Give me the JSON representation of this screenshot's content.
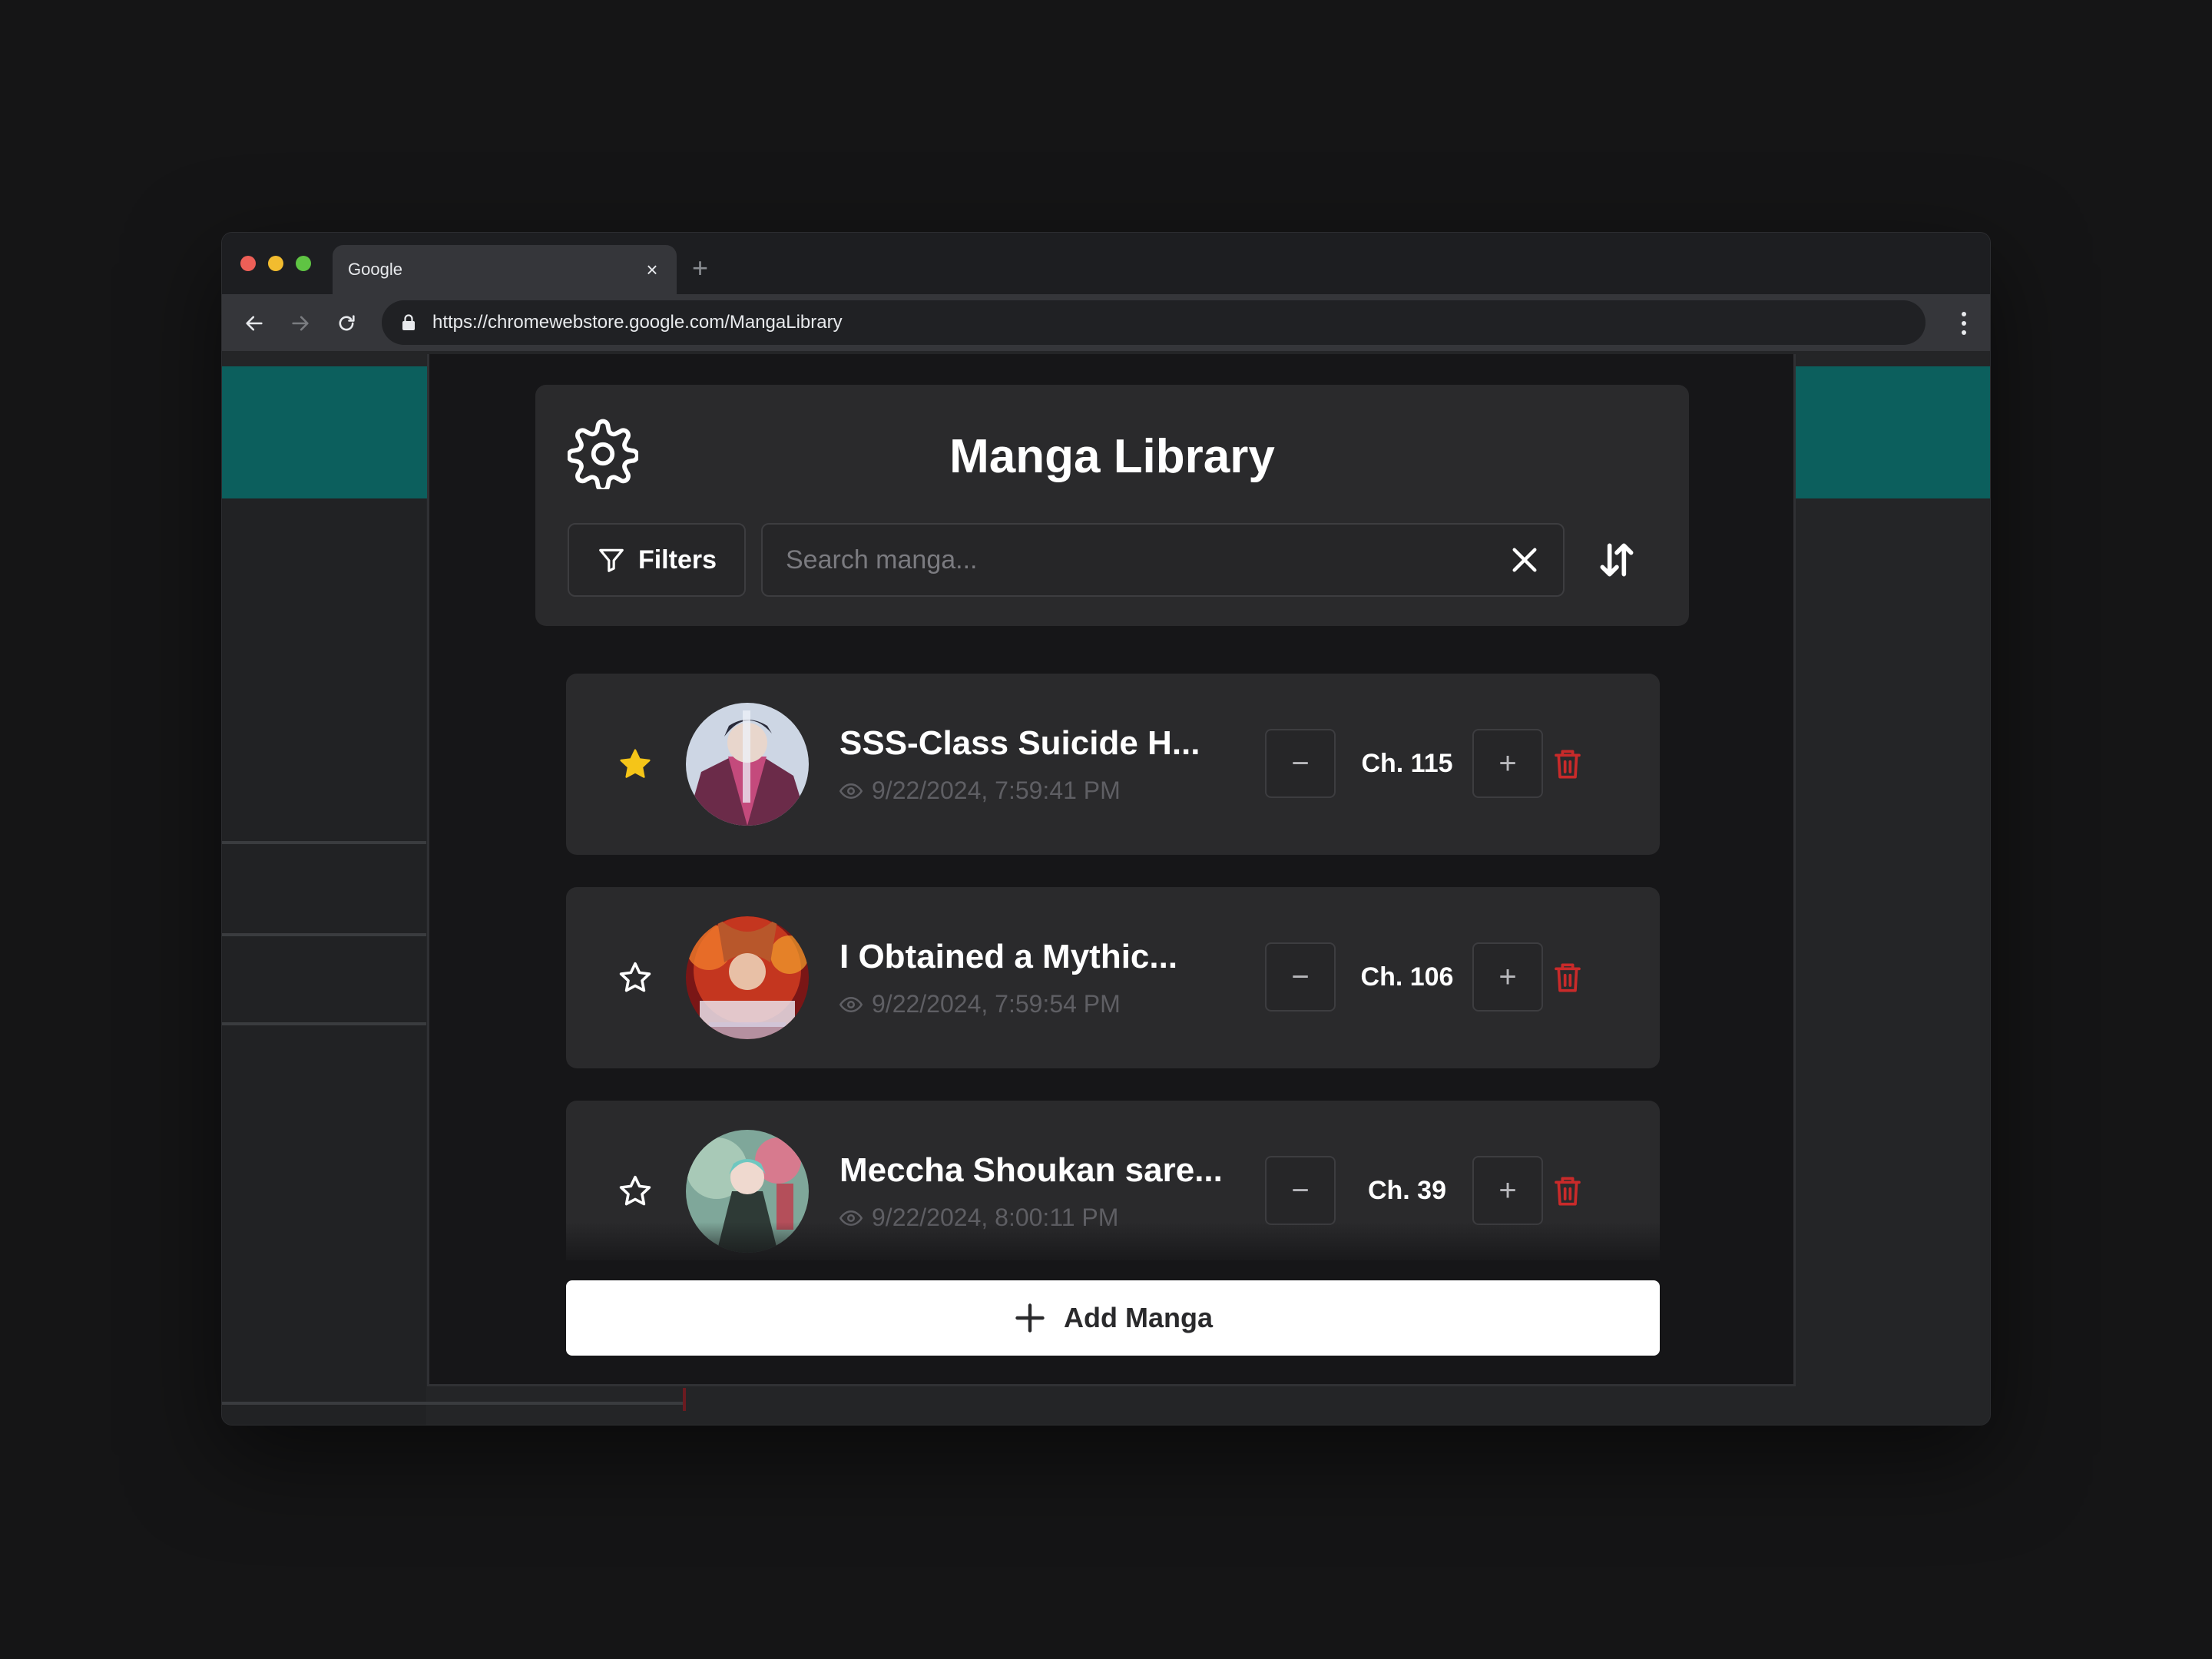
{
  "browser": {
    "tab_title": "Google",
    "tab_close": "×",
    "new_tab": "+",
    "url": "https://chromewebstore.google.com/MangaLibrary"
  },
  "app": {
    "title": "Manga Library",
    "filters_label": "Filters",
    "search_placeholder": "Search manga...",
    "add_label": "Add Manga"
  },
  "manga": [
    {
      "title": "SSS-Class Suicide H...",
      "last_read": "9/22/2024, 7:59:41 PM",
      "chapter": "Ch. 115",
      "favorite": true
    },
    {
      "title": "I Obtained a Mythic...",
      "last_read": "9/22/2024, 7:59:54 PM",
      "chapter": "Ch. 106",
      "favorite": false
    },
    {
      "title": "Meccha Shoukan sare...",
      "last_read": "9/22/2024, 8:00:11 PM",
      "chapter": "Ch. 39",
      "favorite": false
    }
  ],
  "controls": {
    "minus": "−",
    "plus": "+"
  },
  "colors": {
    "favorite_star": "#f5c518",
    "delete": "#c92a2a",
    "page_accent": "#0c5f5d"
  }
}
